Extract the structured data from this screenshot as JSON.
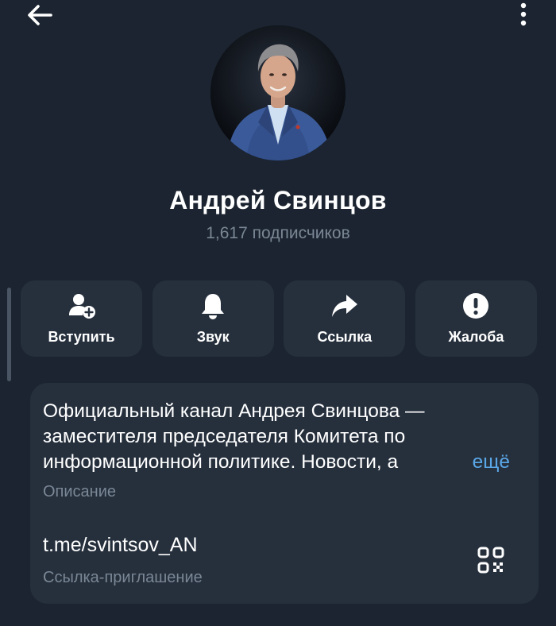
{
  "header": {
    "back_icon": "arrow-left-icon",
    "menu_icon": "more-vertical-icon"
  },
  "channel": {
    "name": "Андрей Свинцов",
    "subscribers": "1,617 подписчиков",
    "avatar": "channel-avatar-photo"
  },
  "actions": [
    {
      "label": "Вступить",
      "icon": "join-user-plus-icon"
    },
    {
      "label": "Звук",
      "icon": "bell-icon"
    },
    {
      "label": "Ссылка",
      "icon": "share-arrow-icon"
    },
    {
      "label": "Жалоба",
      "icon": "report-exclamation-icon"
    }
  ],
  "info": {
    "description_lines": [
      "Официальный канал Андрея Свинцова —",
      "заместителя председателя Комитета по",
      "информационной политике. Новости, а"
    ],
    "more_label": "ещё",
    "description_caption": "Описание",
    "invite_link": "t.me/svintsov_AN",
    "invite_caption": "Ссылка-приглашение",
    "qr_icon": "qr-code-icon"
  },
  "colors": {
    "background": "#1b2430",
    "card": "#26303d",
    "secondary_text": "#7b8795",
    "accent_link": "#5aa7e8"
  }
}
